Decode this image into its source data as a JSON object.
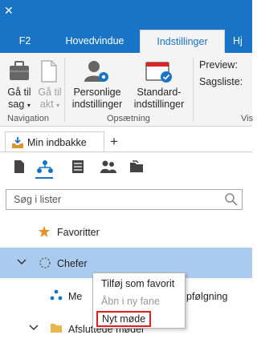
{
  "window": {
    "close_glyph": "✕"
  },
  "tabs": [
    {
      "label": "F2"
    },
    {
      "label": "Hovedvindue"
    },
    {
      "label": "Indstillinger"
    },
    {
      "label": "Hj"
    }
  ],
  "ribbon": {
    "navigation": {
      "label": "Navigation",
      "ga_til_sag": {
        "line1": "Gå til",
        "line2": "sag"
      },
      "ga_til_akt": {
        "line1": "Gå til",
        "line2": "akt"
      }
    },
    "opsaetning": {
      "label": "Opsætning",
      "personlige": {
        "line1": "Personlige",
        "line2": "indstillinger"
      },
      "standard": {
        "line1": "Standard-",
        "line2": "indstillinger"
      }
    },
    "preview_label": "Preview:",
    "sagsliste_label": "Sagsliste:",
    "cut_label": "Vis"
  },
  "doc_tab": {
    "label": "Min indbakke",
    "add": "+"
  },
  "search": {
    "placeholder": "Søg i lister"
  },
  "tree": {
    "favoritter": "Favoritter",
    "chefer": "Chefer",
    "row3_left": "Me",
    "row3_right": "pfølgning",
    "row4": "Afsluttede møder"
  },
  "context_menu": {
    "item1": "Tilføj som favorit",
    "item2": "Åbn i ny fane",
    "item3": "Nyt møde"
  },
  "colors": {
    "accent": "#1a74c6",
    "selection": "#aacbee",
    "highlight": "#e01e1e"
  }
}
